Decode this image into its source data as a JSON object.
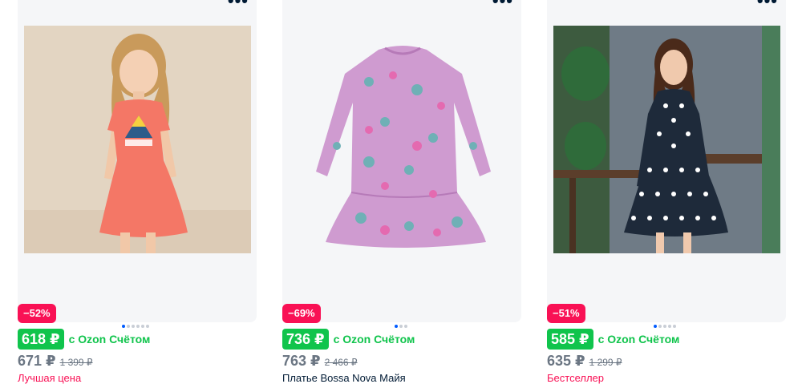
{
  "products": [
    {
      "menu_label": "•••",
      "image_alt": "girl dress coral",
      "discount": "−52%",
      "dots_count": 6,
      "active_dot": 0,
      "card_price": "618 ₽",
      "card_price_label": "с Ozon Счётом",
      "price": "671 ₽",
      "old_price": "1 399 ₽",
      "below_text": "Лучшая цена",
      "below_color": "#f91155"
    },
    {
      "menu_label": "•••",
      "image_alt": "floral dress",
      "discount": "−69%",
      "dots_count": 3,
      "active_dot": 0,
      "card_price": "736 ₽",
      "card_price_label": "с Ozon Счётом",
      "price": "763 ₽",
      "old_price": "2 466 ₽",
      "below_text": "Платье Bossa Nova Майя",
      "below_color": "#001a34"
    },
    {
      "menu_label": "•••",
      "image_alt": "polka dot dress",
      "discount": "−51%",
      "dots_count": 5,
      "active_dot": 0,
      "card_price": "585 ₽",
      "card_price_label": "с Ozon Счётом",
      "price": "635 ₽",
      "old_price": "1 299 ₽",
      "below_text": "Бестселлер",
      "below_color": "#f91155"
    }
  ],
  "colors": {
    "accent_green": "#10c44c",
    "discount_red": "#f91155",
    "dot_active": "#005bff"
  }
}
